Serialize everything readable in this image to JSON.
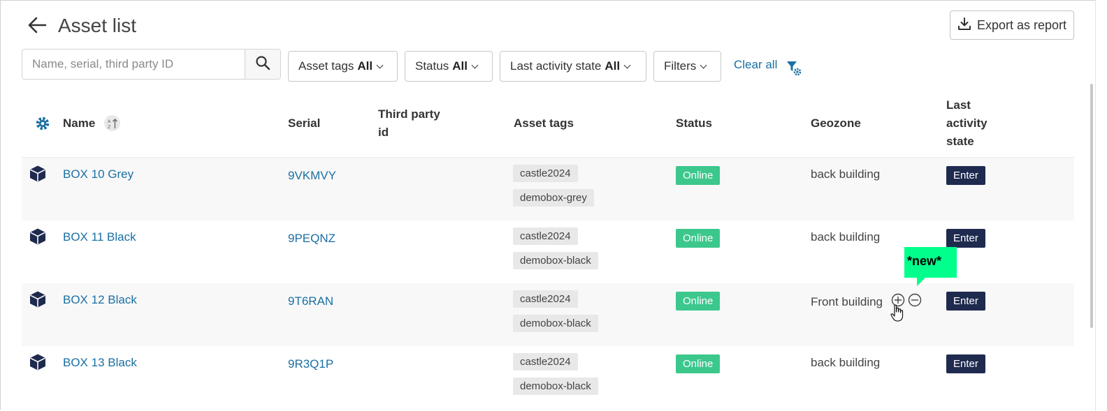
{
  "header": {
    "title": "Asset list",
    "export_label": "Export as report"
  },
  "search": {
    "placeholder": "Name, serial, third party ID",
    "value": ""
  },
  "filters": [
    {
      "label": "Asset tags",
      "value": "All"
    },
    {
      "label": "Status",
      "value": "All"
    },
    {
      "label": "Last activity state",
      "value": "All"
    },
    {
      "label": "Filters",
      "value": ""
    }
  ],
  "clear_all_label": "Clear all",
  "columns": {
    "name": "Name",
    "serial": "Serial",
    "third_party_id": "Third party id",
    "asset_tags": "Asset tags",
    "status": "Status",
    "geozone": "Geozone",
    "last_activity_state": "Last activity state"
  },
  "rows": [
    {
      "name": "BOX 10 Grey",
      "serial": "9VKMVY",
      "tags": [
        "castle2024",
        "demobox-grey"
      ],
      "status": "Online",
      "geozone": "back building",
      "activity": "Enter"
    },
    {
      "name": "BOX 11 Black",
      "serial": "9PEQNZ",
      "tags": [
        "castle2024",
        "demobox-black"
      ],
      "status": "Online",
      "geozone": "back building",
      "activity": "Enter"
    },
    {
      "name": "BOX 12 Black",
      "serial": "9T6RAN",
      "tags": [
        "castle2024",
        "demobox-black"
      ],
      "status": "Online",
      "geozone": "Front building",
      "activity": "Enter"
    },
    {
      "name": "BOX 13 Black",
      "serial": "9R3Q1P",
      "tags": [
        "castle2024",
        "demobox-black"
      ],
      "status": "Online",
      "geozone": "back building",
      "activity": "Enter"
    }
  ],
  "tooltip": {
    "text": "*new*"
  },
  "colors": {
    "link": "#1a6fa3",
    "online": "#3cc78d",
    "enter": "#1f2a4f",
    "tooltip": "#00ff8c"
  }
}
